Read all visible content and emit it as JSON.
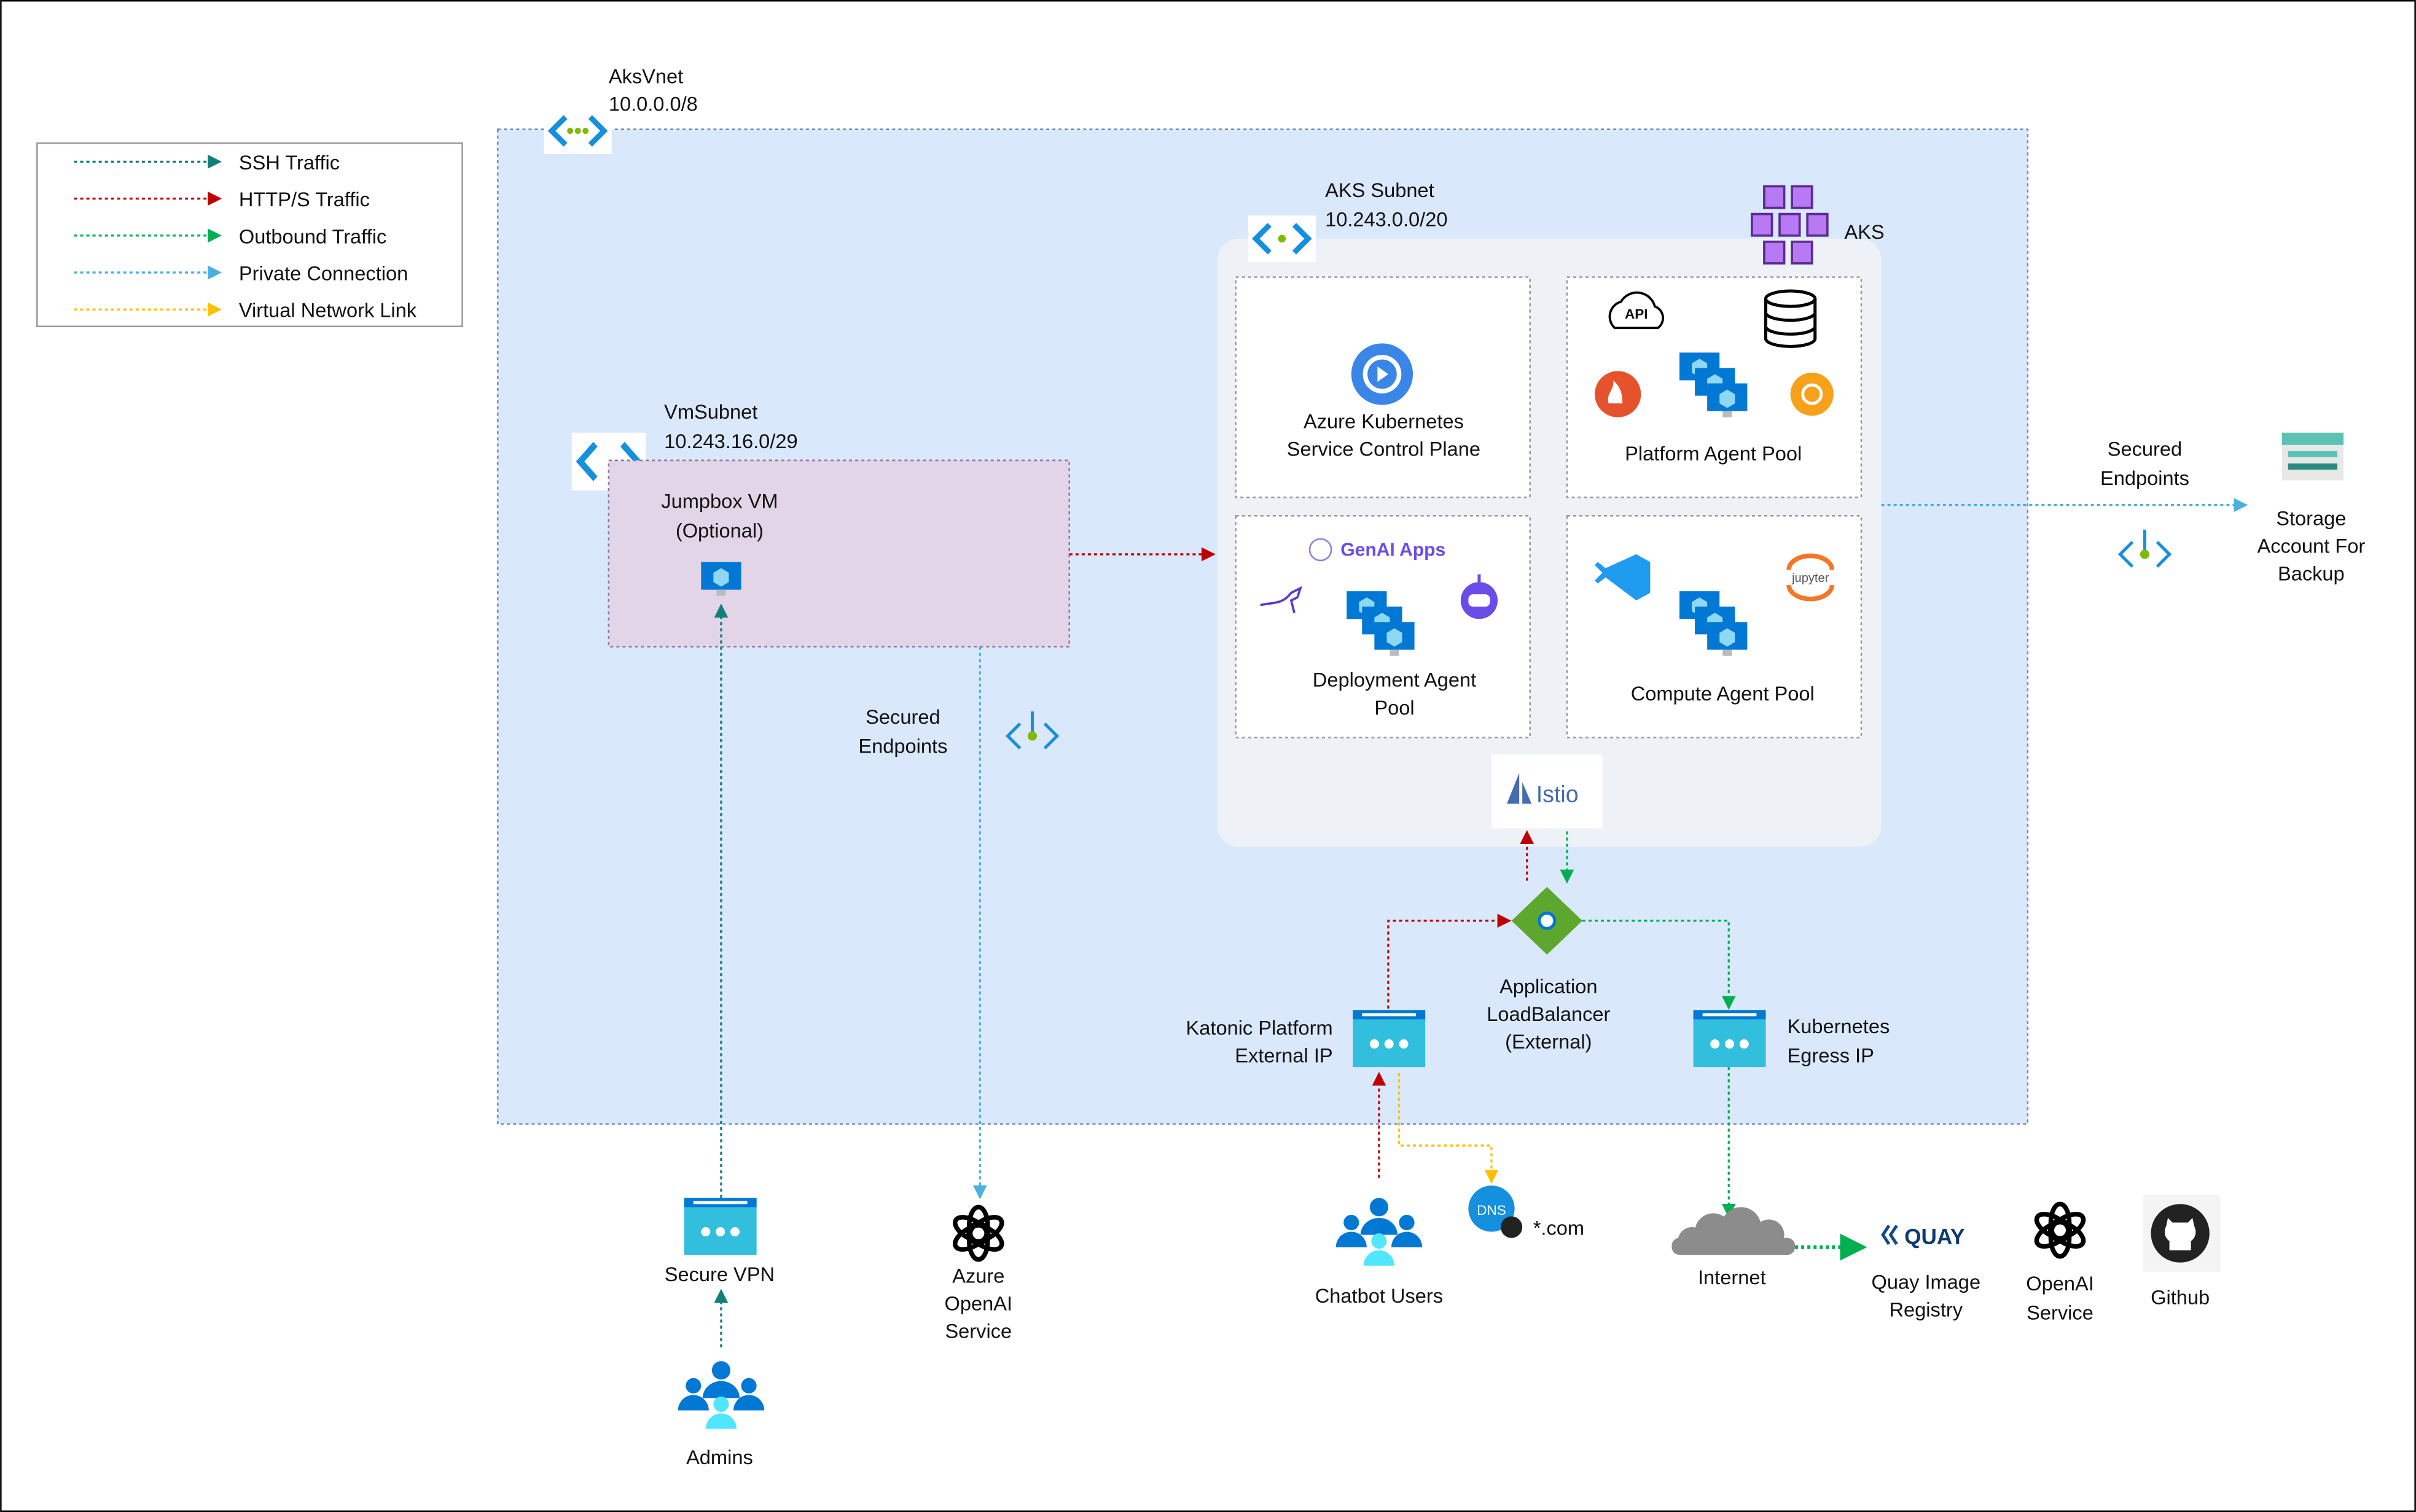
{
  "colors": {
    "ssh": "#137f7a",
    "http": "#c00000",
    "outbound": "#00b050",
    "private": "#4ab0e0",
    "vnet_link": "#ffc000",
    "vnet_bg": "#dae8fc",
    "aks_bg": "#eef2f7",
    "vm_subnet_bg": "#e1d5e7"
  },
  "legend": [
    {
      "label": "SSH Traffic",
      "color": "#137f7a"
    },
    {
      "label": "HTTP/S Traffic",
      "color": "#c00000"
    },
    {
      "label": "Outbound Traffic",
      "color": "#00b050"
    },
    {
      "label": "Private Connection",
      "color": "#4ab0e0"
    },
    {
      "label": "Virtual Network Link",
      "color": "#ffc000"
    }
  ],
  "vnet": {
    "name": "AksVnet",
    "cidr": "10.0.0.0/8",
    "icon": "vnet-icon"
  },
  "aks_subnet": {
    "name": "AKS Subnet",
    "cidr": "10.243.0.0/20",
    "aks_label": "AKS"
  },
  "pools": {
    "control_plane": [
      "Azure Kubernetes",
      "Service Control Plane"
    ],
    "platform": "Platform Agent Pool",
    "platform_api": "API",
    "genai": "GenAI Apps",
    "deployment": [
      "Deployment Agent",
      "Pool"
    ],
    "compute": "Compute Agent Pool",
    "jupyter": "jupyter"
  },
  "istio": "Istio",
  "vm_subnet": {
    "name": "VmSubnet",
    "cidr": "10.243.16.0/29",
    "jumpbox": [
      "Jumpbox VM",
      "(Optional)"
    ]
  },
  "secured_endpoints": [
    "Secured",
    "Endpoints"
  ],
  "load_balancer": [
    "Application",
    "LoadBalancer",
    "(External)"
  ],
  "katonic_ip": [
    "Katonic Platform",
    "External IP"
  ],
  "egress_ip": [
    "Kubernetes",
    "Egress IP"
  ],
  "external": {
    "secure_vpn": "Secure VPN",
    "admins": "Admins",
    "azure_openai": [
      "Azure",
      "OpenAI",
      "Service"
    ],
    "chatbot_users": "Chatbot Users",
    "dns": "DNS",
    "dns_domain": "*.com",
    "internet": "Internet",
    "quay_logo": "QUAY",
    "quay": [
      "Quay Image",
      "Registry"
    ],
    "openai": [
      "OpenAI",
      "Service"
    ],
    "github": "Github",
    "storage": [
      "Storage",
      "Account For",
      "Backup"
    ]
  }
}
